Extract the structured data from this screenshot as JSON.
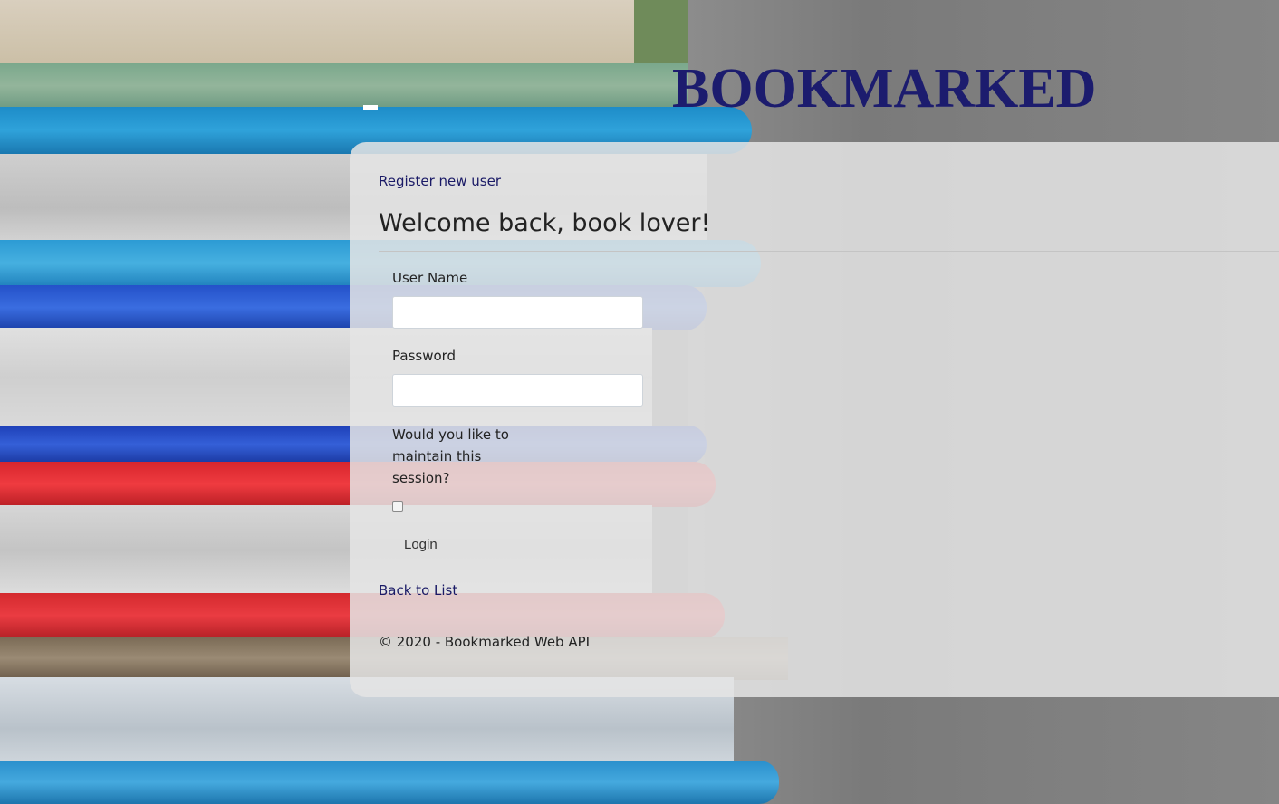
{
  "brand": {
    "name": "BOOKMARKED"
  },
  "nav": {
    "register_label": "Register new user"
  },
  "page": {
    "title": "Welcome back, book lover!"
  },
  "form": {
    "username_label": "User Name",
    "username_value": "",
    "password_label": "Password",
    "password_value": "",
    "session_label": "Would you like to maintain this session?",
    "session_checked": false,
    "login_label": "Login"
  },
  "links": {
    "back_label": "Back to List"
  },
  "footer": {
    "text": "© 2020 - Bookmarked Web API"
  },
  "colors": {
    "brand": "#1c1c6e",
    "link": "#1a1a66"
  }
}
